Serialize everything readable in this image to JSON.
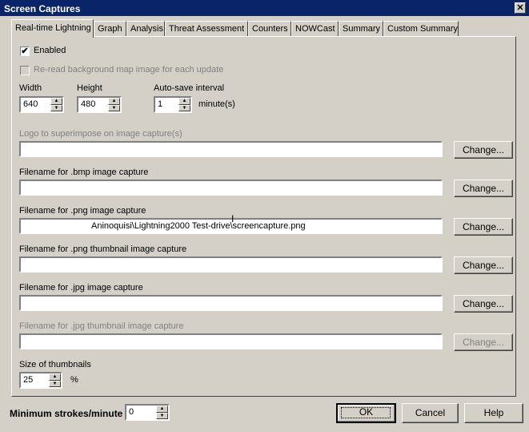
{
  "window": {
    "title": "Screen Captures",
    "close_glyph": "✕"
  },
  "tabs": [
    {
      "label": "Real-time Lightning",
      "active": true
    },
    {
      "label": "Graph"
    },
    {
      "label": "Analysis"
    },
    {
      "label": "Threat Assessment"
    },
    {
      "label": "Counters"
    },
    {
      "label": "NOWCast"
    },
    {
      "label": "Summary"
    },
    {
      "label": "Custom Summary"
    }
  ],
  "enabled": {
    "label": "Enabled",
    "checked": true,
    "mark": "✔"
  },
  "reread": {
    "label": "Re-read background map image for each update",
    "checked": false
  },
  "width": {
    "label": "Width",
    "value": "640"
  },
  "height": {
    "label": "Height",
    "value": "480"
  },
  "autosave": {
    "label": "Auto-save interval",
    "value": "1",
    "unit": "minute(s)"
  },
  "logo": {
    "label": "Logo to superimpose on image capture(s)",
    "value": "",
    "button": "Change..."
  },
  "bmp": {
    "label": "Filename for .bmp image capture",
    "value": "",
    "button": "Change..."
  },
  "png": {
    "label": "Filename for .png image capture",
    "value": "Aninoquisi\\Lightning2000 Test-drive\\screencapture.png",
    "button": "Change..."
  },
  "png_thumb": {
    "label": "Filename for .png thumbnail image capture",
    "value": "",
    "button": "Change..."
  },
  "jpg": {
    "label": "Filename for .jpg image capture",
    "value": "",
    "button": "Change..."
  },
  "jpg_thumb": {
    "label": "Filename for .jpg thumbnail image capture",
    "value": "",
    "button": "Change..."
  },
  "thumb_size": {
    "label": "Size of thumbnails",
    "value": "25",
    "unit": "%"
  },
  "min_strokes": {
    "label": "Minimum strokes/minute",
    "value": "0"
  },
  "buttons": {
    "ok": "OK",
    "cancel": "Cancel",
    "help": "Help"
  },
  "spin_glyphs": {
    "up": "▲",
    "down": "▼"
  }
}
